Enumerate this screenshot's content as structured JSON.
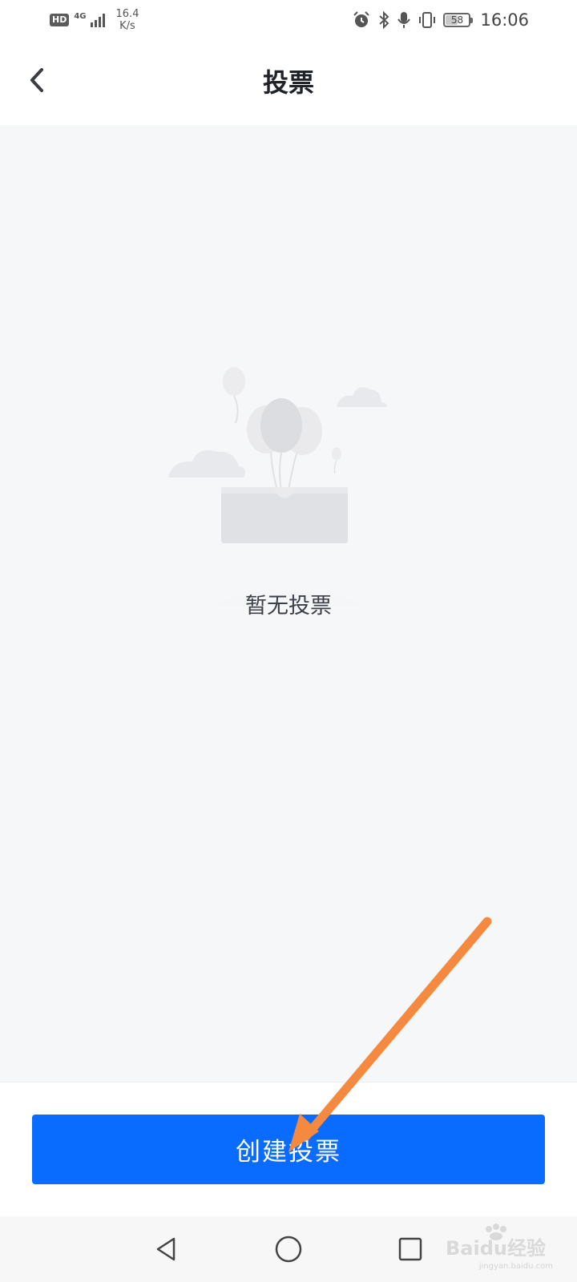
{
  "status_bar": {
    "hd": "HD",
    "network": "4G",
    "speed_value": "16.4",
    "speed_unit": "K/s",
    "battery": "58",
    "battery_level": 0.58,
    "time": "16:06",
    "icons": [
      "alarm-icon",
      "bluetooth-icon",
      "mic-icon",
      "vibrate-icon"
    ]
  },
  "nav": {
    "title": "投票",
    "back_icon": "chevron-left-icon"
  },
  "empty_state": {
    "message": "暂无投票",
    "illustration": "empty-box-balloons-illustration"
  },
  "footer": {
    "create_button": "创建投票"
  },
  "annotation": {
    "arrow_color": "#f5893f"
  },
  "colors": {
    "primary": "#0a6cff",
    "background": "#f6f7f9"
  },
  "system_nav": {
    "back": "triangle-back-icon",
    "home": "circle-home-icon",
    "recents": "square-recents-icon"
  },
  "watermark": {
    "brand": "Baidu经验",
    "url": "jingyan.baidu.com"
  }
}
